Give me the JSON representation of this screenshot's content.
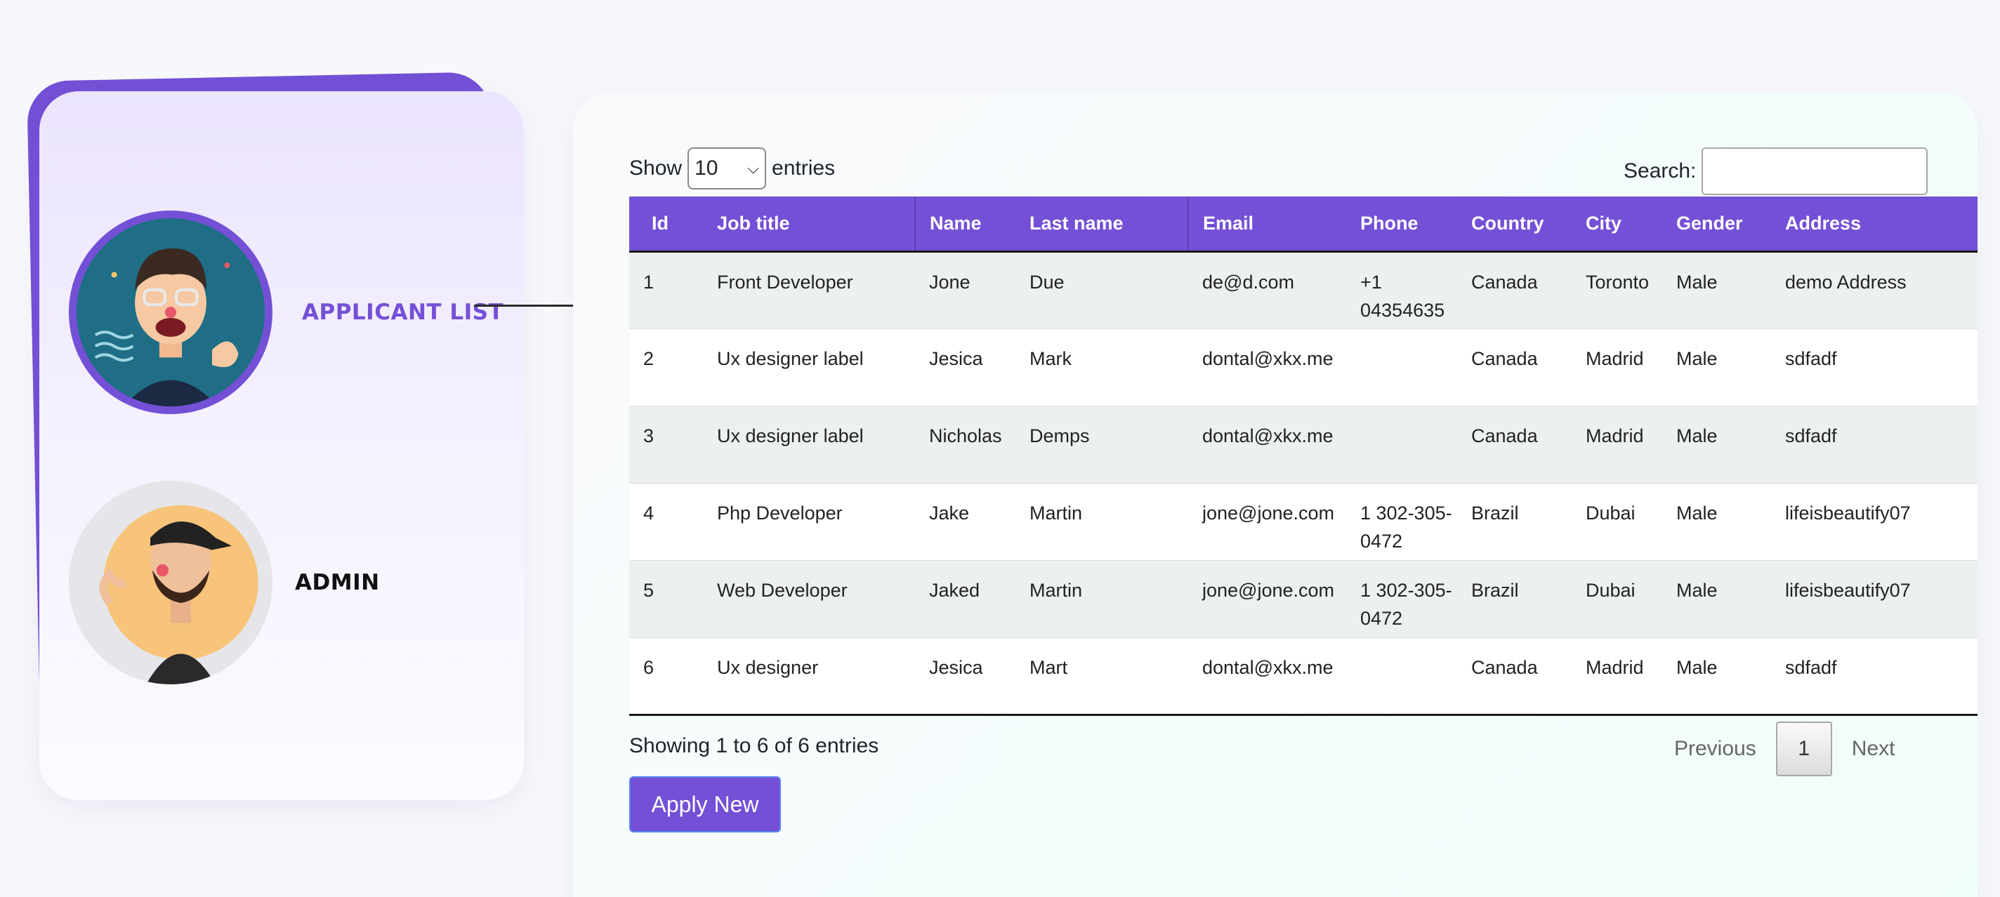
{
  "sidebar": {
    "items": [
      {
        "label": "APPLICANT LIST",
        "avatar": "avatar-glasses-man-icon"
      },
      {
        "label": "ADMIN",
        "avatar": "avatar-bearded-man-icon"
      }
    ]
  },
  "table_controls": {
    "show_label": "Show",
    "length_value": "10",
    "entries_label": "entries",
    "search_label": "Search:",
    "search_value": ""
  },
  "table": {
    "headers": [
      "Id",
      "Job title",
      "Name",
      "Last name",
      "Email",
      "Phone",
      "Country",
      "City",
      "Gender",
      "Address"
    ],
    "rows": [
      [
        "1",
        "Front Developer",
        "Jone",
        "Due",
        "de@d.com",
        "+1 04354635",
        "Canada",
        "Toronto",
        "Male",
        "demo Address"
      ],
      [
        "2",
        "Ux designer label",
        "Jesica",
        "Mark",
        "dontal@xkx.me",
        "",
        "Canada",
        "Madrid",
        "Male",
        "sdfadf"
      ],
      [
        "3",
        "Ux designer label",
        "Nicholas",
        "Demps",
        "dontal@xkx.me",
        "",
        "Canada",
        "Madrid",
        "Male",
        "sdfadf"
      ],
      [
        "4",
        "Php Developer",
        "Jake",
        "Martin",
        "jone@jone.com",
        "1 302-305-0472",
        "Brazil",
        "Dubai",
        "Male",
        "lifeisbeautify07"
      ],
      [
        "5",
        "Web Developer",
        "Jaked",
        "Martin",
        "jone@jone.com",
        "1 302-305-0472",
        "Brazil",
        "Dubai",
        "Male",
        "lifeisbeautify07"
      ],
      [
        "6",
        "Ux designer",
        "Jesica",
        "Mart",
        "dontal@xkx.me",
        "",
        "Canada",
        "Madrid",
        "Male",
        "sdfadf"
      ]
    ]
  },
  "footer": {
    "info": "Showing 1 to 6 of 6 entries",
    "previous": "Previous",
    "current_page": "1",
    "next": "Next",
    "apply_button": "Apply New"
  },
  "colors": {
    "accent": "#7450d6",
    "row_stripe": "#ecf0ef"
  }
}
